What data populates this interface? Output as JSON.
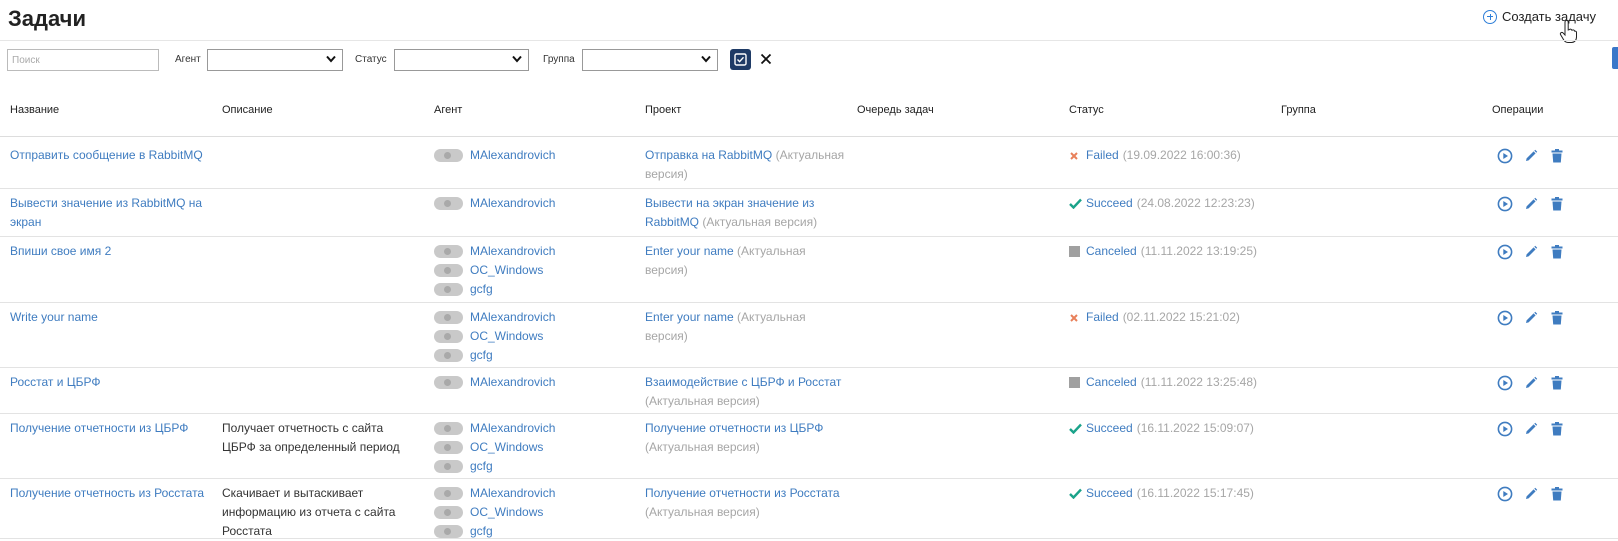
{
  "page": {
    "title": "Задачи",
    "create_label": "Создать задачу"
  },
  "filters": {
    "search_placeholder": "Поиск",
    "agent_label": "Агент",
    "status_label": "Статус",
    "group_label": "Группа"
  },
  "columns": [
    "Название",
    "Описание",
    "Агент",
    "Проект",
    "Очередь задач",
    "Статус",
    "Группа",
    "Операции"
  ],
  "tasks": [
    {
      "name": [
        "Отправить сообщение в RabbitMQ"
      ],
      "description": [],
      "agents": [
        "MAlexandrovich"
      ],
      "project": [
        {
          "link": "Отправка на RabbitMQ",
          "grey": " (Актуальная"
        },
        {
          "grey": "версия)"
        }
      ],
      "status": {
        "icon": "failed-x-icon",
        "label": "Failed",
        "time": "(19.09.2022 16:00:36)"
      }
    },
    {
      "name": [
        "Вывести значение из RabbitMQ на",
        "экран"
      ],
      "description": [],
      "agents": [
        "MAlexandrovich"
      ],
      "project": [
        {
          "link": "Вывести на экран значение из"
        },
        {
          "link": "RabbitMQ",
          "grey": " (Актуальная версия)"
        }
      ],
      "status": {
        "icon": "succeed-check-icon",
        "label": "Succeed",
        "time": "(24.08.2022 12:23:23)"
      }
    },
    {
      "name": [
        "Впиши свое имя 2"
      ],
      "description": [],
      "agents": [
        "MAlexandrovich",
        "OC_Windows",
        "gcfg"
      ],
      "project": [
        {
          "link": "Enter your name",
          "grey": " (Актуальная"
        },
        {
          "grey": "версия)"
        }
      ],
      "status": {
        "icon": "canceled-square-icon",
        "label": "Canceled",
        "time": "(11.11.2022 13:19:25)"
      }
    },
    {
      "name": [
        "Write your name"
      ],
      "description": [],
      "agents": [
        "MAlexandrovich",
        "OC_Windows",
        "gcfg"
      ],
      "project": [
        {
          "link": "Enter your name",
          "grey": " (Актуальная"
        },
        {
          "grey": "версия)"
        }
      ],
      "status": {
        "icon": "failed-x-icon",
        "label": "Failed",
        "time": "(02.11.2022 15:21:02)"
      }
    },
    {
      "name": [
        "Росстат и ЦБРФ"
      ],
      "description": [],
      "agents": [
        "MAlexandrovich"
      ],
      "project": [
        {
          "link": "Взаимодействие с ЦБРФ и Росстат"
        },
        {
          "grey": "(Актуальная версия)"
        }
      ],
      "status": {
        "icon": "canceled-square-icon",
        "label": "Canceled",
        "time": "(11.11.2022 13:25:48)"
      }
    },
    {
      "name": [
        "Получение отчетности из ЦБРФ"
      ],
      "description": [
        "Получает отчетность с сайта",
        "ЦБРФ за определенный период"
      ],
      "agents": [
        "MAlexandrovich",
        "OC_Windows",
        "gcfg"
      ],
      "project": [
        {
          "link": "Получение отчетности из ЦБРФ"
        },
        {
          "grey": "(Актуальная версия)"
        }
      ],
      "status": {
        "icon": "succeed-check-icon",
        "label": "Succeed",
        "time": "(16.11.2022 15:09:07)"
      }
    },
    {
      "name": [
        "Получение отчетность из Росстата"
      ],
      "description": [
        "Скачивает и вытаскивает",
        "информацию из отчета с сайта",
        "Росстата"
      ],
      "agents": [
        "MAlexandrovich",
        "OC_Windows",
        "gcfg"
      ],
      "project": [
        {
          "link": "Получение отчетности из Росстата"
        },
        {
          "grey": "(Актуальная версия)"
        }
      ],
      "status": {
        "icon": "succeed-check-icon",
        "label": "Succeed",
        "time": "(16.11.2022 15:17:45)"
      }
    }
  ],
  "colors": {
    "link": "#3f7cc0",
    "muted": "#a6a6a6",
    "failed": "#e8805a",
    "succeed": "#1aa38a",
    "canceled": "#a0a0a0",
    "accent_dark": "#1f3b66"
  }
}
